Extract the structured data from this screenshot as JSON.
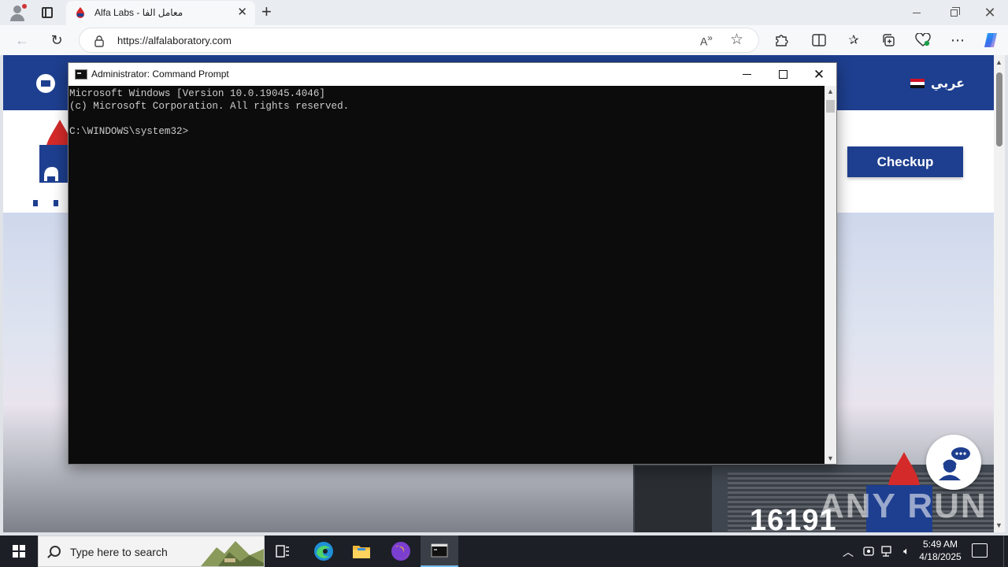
{
  "browser": {
    "tab": {
      "title": "Alfa Labs - معامل الفا",
      "close_glyph": "✕"
    },
    "new_tab_glyph": "+",
    "address": {
      "url": "https://alfalaboratory.com"
    },
    "window_controls": {
      "minimize": "",
      "restore": "",
      "close": "✕"
    },
    "icons": [
      "back-arrow-icon",
      "reload-icon",
      "lock-icon",
      "read-aloud-icon",
      "favorite-star-icon",
      "extensions-icon",
      "split-screen-icon",
      "favorites-icon",
      "collections-icon",
      "performance-icon",
      "more-menu-icon",
      "copilot-icon"
    ]
  },
  "website": {
    "language_label": "عربي",
    "checkup_label": "Checkup",
    "hotline": "16191",
    "brand_color": "#1e3f8f"
  },
  "cmd": {
    "title": "Administrator: Command Prompt",
    "lines": [
      "Microsoft Windows [Version 10.0.19045.4046]",
      "(c) Microsoft Corporation. All rights reserved.",
      "",
      "C:\\WINDOWS\\system32>"
    ]
  },
  "taskbar": {
    "search_placeholder": "Type here to search",
    "apps": [
      "task-view-icon",
      "edge-icon",
      "file-explorer-icon",
      "firefox-icon",
      "command-prompt-icon"
    ],
    "clock": {
      "time": "5:49 AM",
      "date": "4/18/2025"
    }
  },
  "watermark": "ANY RUN"
}
